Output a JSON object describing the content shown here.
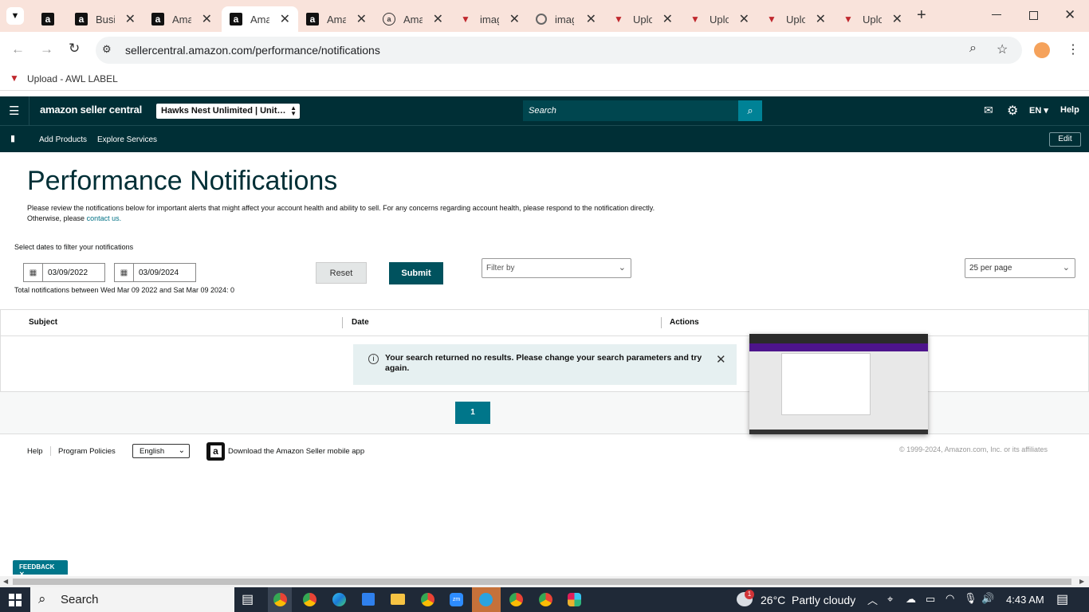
{
  "browser": {
    "tabs": [
      {
        "title": "",
        "icon": "amazon-icon"
      },
      {
        "title": "Busi",
        "icon": "amazon-icon"
      },
      {
        "title": "Ama",
        "icon": "amazon-icon"
      },
      {
        "title": "Ama",
        "icon": "amazon-icon",
        "active": true
      },
      {
        "title": "Ama",
        "icon": "amazon-icon"
      },
      {
        "title": "Ama",
        "icon": "amazon-a-circle-icon"
      },
      {
        "title": "imag",
        "icon": "awl-icon"
      },
      {
        "title": "imag",
        "icon": "google-icon"
      },
      {
        "title": "Uplo",
        "icon": "awl-icon"
      },
      {
        "title": "Uplo",
        "icon": "awl-icon"
      },
      {
        "title": "Uplo",
        "icon": "awl-icon"
      },
      {
        "title": "Uplo",
        "icon": "awl-icon"
      }
    ],
    "url": "sellercentral.amazon.com/performance/notifications",
    "bookmark": "Upload - AWL LABEL",
    "tab_bg": "#f9e3db"
  },
  "seller_header": {
    "logo": "amazon seller central",
    "account": "Hawks Nest Unlimited | Unit…",
    "search_placeholder": "Search",
    "lang": "EN",
    "help": "Help",
    "nav": [
      "Add Products",
      "Explore Services"
    ],
    "edit": "Edit",
    "bg": "#002f36",
    "accent": "#008296"
  },
  "page": {
    "title": "Performance Notifications",
    "intro_1": "Please review the notifications below for important alerts that might affect your account health and ability to sell. For any concerns regarding account health, please respond to the notification directly.",
    "intro_2": "Otherwise, please",
    "contact_link": "contact us.",
    "filter_label": "Select dates to filter your notifications",
    "date_from": "03/09/2022",
    "date_to": "03/09/2024",
    "reset": "Reset",
    "submit": "Submit",
    "filter_by": "Filter by",
    "per_page": "25 per page",
    "total": "Total notifications between Wed Mar 09 2022 and Sat Mar 09 2024: 0",
    "columns": [
      "Subject",
      "Date",
      "Actions"
    ],
    "no_results": "Your search returned no results. Please change your search parameters and try again.",
    "page_num": "1"
  },
  "footer": {
    "links": [
      "Help",
      "Program Policies"
    ],
    "language": "English",
    "app_text": "Download the Amazon Seller mobile app",
    "copyright": "© 1999-2024, Amazon.com, Inc. or its affiliates",
    "feedback": "FEEDBACK"
  },
  "taskbar": {
    "search": "Search",
    "weather": "26°C  Partly cloudy",
    "time": "4:43 AM",
    "badge": "1"
  }
}
